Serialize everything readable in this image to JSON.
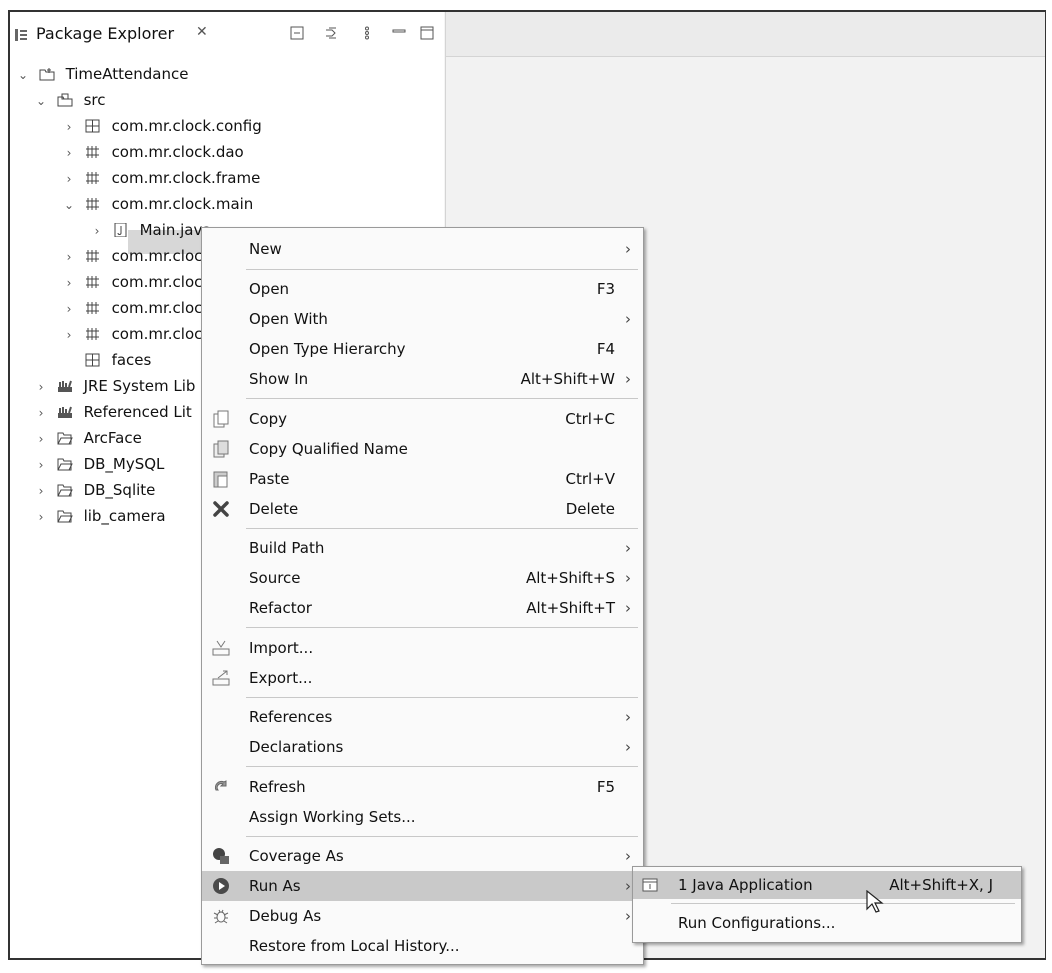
{
  "explorer": {
    "title": "Package Explorer",
    "close_glyph": "✕",
    "toolbar_icons": [
      "collapse-all-icon",
      "link-with-editor-icon",
      "view-menu-icon",
      "minimize-icon",
      "maximize-icon"
    ],
    "tree": [
      {
        "label": "TimeAttendance",
        "icon": "project-icon",
        "twisty": "expanded"
      },
      {
        "label": "src",
        "icon": "source-folder-icon",
        "twisty": "expanded"
      },
      {
        "label": "com.mr.clock.config",
        "icon": "package-icon",
        "twisty": "collapsed"
      },
      {
        "label": "com.mr.clock.dao",
        "icon": "package-icon",
        "twisty": "collapsed"
      },
      {
        "label": "com.mr.clock.frame",
        "icon": "package-icon",
        "twisty": "collapsed"
      },
      {
        "label": "com.mr.clock.main",
        "icon": "package-icon",
        "twisty": "expanded"
      },
      {
        "label": "Main.java",
        "icon": "java-file-icon",
        "twisty": "collapsed"
      },
      {
        "label": "com.mr.cloc",
        "icon": "package-icon",
        "twisty": "collapsed"
      },
      {
        "label": "com.mr.cloc",
        "icon": "package-icon",
        "twisty": "collapsed"
      },
      {
        "label": "com.mr.cloc",
        "icon": "package-icon",
        "twisty": "collapsed"
      },
      {
        "label": "com.mr.cloc",
        "icon": "package-icon",
        "twisty": "collapsed"
      },
      {
        "label": "faces",
        "icon": "package-icon",
        "twisty": "none"
      },
      {
        "label": "JRE System Lib",
        "icon": "library-icon",
        "twisty": "collapsed"
      },
      {
        "label": "Referenced Lit",
        "icon": "library-icon",
        "twisty": "collapsed"
      },
      {
        "label": "ArcFace",
        "icon": "folder-icon",
        "twisty": "collapsed"
      },
      {
        "label": "DB_MySQL",
        "icon": "folder-icon",
        "twisty": "collapsed"
      },
      {
        "label": "DB_Sqlite",
        "icon": "folder-icon",
        "twisty": "collapsed"
      },
      {
        "label": "lib_camera",
        "icon": "folder-icon",
        "twisty": "collapsed"
      }
    ]
  },
  "menu": {
    "items": [
      {
        "label": "New",
        "shortcut": "",
        "submenu": true,
        "icon": ""
      },
      {
        "label": "Open",
        "shortcut": "F3",
        "submenu": false,
        "icon": ""
      },
      {
        "label": "Open With",
        "shortcut": "",
        "submenu": true,
        "icon": ""
      },
      {
        "label": "Open Type Hierarchy",
        "shortcut": "F4",
        "submenu": false,
        "icon": ""
      },
      {
        "label": "Show In",
        "shortcut": "Alt+Shift+W",
        "submenu": true,
        "icon": ""
      },
      {
        "label": "Copy",
        "shortcut": "Ctrl+C",
        "submenu": false,
        "icon": "copy-icon"
      },
      {
        "label": "Copy Qualified Name",
        "shortcut": "",
        "submenu": false,
        "icon": "copy-qualified-name-icon"
      },
      {
        "label": "Paste",
        "shortcut": "Ctrl+V",
        "submenu": false,
        "icon": "paste-icon"
      },
      {
        "label": "Delete",
        "shortcut": "Delete",
        "submenu": false,
        "icon": "delete-icon"
      },
      {
        "label": "Build Path",
        "shortcut": "",
        "submenu": true,
        "icon": ""
      },
      {
        "label": "Source",
        "shortcut": "Alt+Shift+S",
        "submenu": true,
        "icon": ""
      },
      {
        "label": "Refactor",
        "shortcut": "Alt+Shift+T",
        "submenu": true,
        "icon": ""
      },
      {
        "label": "Import...",
        "shortcut": "",
        "submenu": false,
        "icon": "import-icon"
      },
      {
        "label": "Export...",
        "shortcut": "",
        "submenu": false,
        "icon": "export-icon"
      },
      {
        "label": "References",
        "shortcut": "",
        "submenu": true,
        "icon": ""
      },
      {
        "label": "Declarations",
        "shortcut": "",
        "submenu": true,
        "icon": ""
      },
      {
        "label": "Refresh",
        "shortcut": "F5",
        "submenu": false,
        "icon": "refresh-icon"
      },
      {
        "label": "Assign Working Sets...",
        "shortcut": "",
        "submenu": false,
        "icon": ""
      },
      {
        "label": "Coverage As",
        "shortcut": "",
        "submenu": true,
        "icon": "coverage-icon"
      },
      {
        "label": "Run As",
        "shortcut": "",
        "submenu": true,
        "icon": "run-icon"
      },
      {
        "label": "Debug As",
        "shortcut": "",
        "submenu": true,
        "icon": "debug-icon"
      },
      {
        "label": "Restore from Local History...",
        "shortcut": "",
        "submenu": false,
        "icon": ""
      }
    ],
    "submenu_glyph": "›"
  },
  "run_as_submenu": {
    "items": [
      {
        "label": "1 Java Application",
        "shortcut": "Alt+Shift+X, J",
        "icon": "java-application-icon"
      },
      {
        "label": "Run Configurations...",
        "shortcut": "",
        "icon": ""
      }
    ]
  },
  "twisty_glyphs": {
    "expanded": "⌄",
    "collapsed": "›",
    "none": ""
  },
  "colors": {
    "highlight": "#c9c9c9",
    "selection": "#d7d7d7",
    "run_icon": "#4a4a4a"
  }
}
